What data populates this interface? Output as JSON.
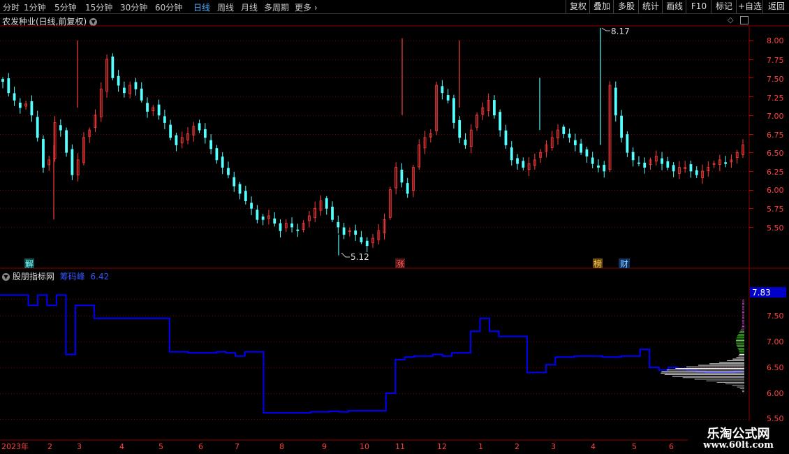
{
  "toolbar": {
    "periods": [
      "分时",
      "1分钟",
      "5分钟",
      "15分钟",
      "30分钟",
      "60分钟",
      "日线",
      "周线",
      "月线",
      "多周期",
      "更多"
    ],
    "active_period": "日线",
    "right_buttons": [
      "复权",
      "叠加",
      "多股",
      "统计",
      "画线",
      "F10",
      "标记",
      "+自选",
      "返回"
    ]
  },
  "main_panel": {
    "title": "农发种业(日线,前复权)",
    "high_label": "8.17",
    "low_label": "5.12",
    "y_ticks": [
      "8.00",
      "7.75",
      "7.50",
      "7.25",
      "7.00",
      "6.75",
      "6.50",
      "6.25",
      "6.00",
      "5.75",
      "5.50"
    ],
    "markers": [
      "解",
      "涨",
      "榜",
      "财"
    ]
  },
  "indicator_panel": {
    "title": "股朋指标网",
    "line_name": "筹码峰",
    "line_value": "6.42",
    "y_ticks": [
      "7.50",
      "7.00",
      "6.50",
      "6.00",
      "5.50"
    ],
    "current_label": "7.83"
  },
  "x_axis": {
    "labels": [
      "2023年",
      "2",
      "3",
      "4",
      "5",
      "6",
      "7",
      "8",
      "9",
      "10",
      "11",
      "12",
      "1",
      "2",
      "3",
      "4",
      "5",
      "6"
    ]
  },
  "watermark": {
    "line1": "乐淘公式网",
    "line2": "www.60lt.com"
  },
  "colors": {
    "up": "#ff3c3c",
    "down": "#54ffff",
    "indicator_line": "#0000ff",
    "active": "#4fb0ff"
  },
  "chart_data": {
    "type": "candlestick",
    "y_range": [
      5.2,
      8.15
    ],
    "high": 8.17,
    "low": 5.12,
    "close_series": [
      7.45,
      7.3,
      7.2,
      7.1,
      7.15,
      7.0,
      6.7,
      6.3,
      6.4,
      6.9,
      6.8,
      6.5,
      6.2,
      6.4,
      6.7,
      6.8,
      7.0,
      7.35,
      7.75,
      7.5,
      7.4,
      7.3,
      7.4,
      7.35,
      7.2,
      7.05,
      7.1,
      7.0,
      6.9,
      6.7,
      6.6,
      6.7,
      6.75,
      6.85,
      6.8,
      6.7,
      6.55,
      6.4,
      6.3,
      6.2,
      6.05,
      5.95,
      5.85,
      5.75,
      5.6,
      5.6,
      5.65,
      5.55,
      5.45,
      5.55,
      5.5,
      5.45,
      5.55,
      5.65,
      5.75,
      5.85,
      5.75,
      5.6,
      5.5,
      5.4,
      5.45,
      5.4,
      5.3,
      5.25,
      5.35,
      5.45,
      5.6,
      6.0,
      6.3,
      6.1,
      5.95,
      6.3,
      6.6,
      6.7,
      6.75,
      7.4,
      7.3,
      7.2,
      6.9,
      6.7,
      6.6,
      6.8,
      7.0,
      7.1,
      7.2,
      7.0,
      6.8,
      6.6,
      6.4,
      6.35,
      6.3,
      6.35,
      6.4,
      6.5,
      6.6,
      6.7,
      6.8,
      6.75,
      6.7,
      6.6,
      6.5,
      6.45,
      6.35,
      6.3,
      6.25,
      7.4,
      7.0,
      6.7,
      6.5,
      6.4,
      6.35,
      6.3,
      6.4,
      6.45,
      6.35,
      6.3,
      6.25,
      6.3,
      6.3,
      6.25,
      6.2,
      6.25,
      6.3,
      6.35,
      6.4,
      6.35,
      6.4,
      6.5,
      6.6
    ],
    "indicator_series": [
      7.9,
      7.9,
      7.9,
      7.7,
      7.9,
      7.7,
      7.9,
      6.75,
      7.7,
      7.7,
      7.45,
      7.45,
      7.45,
      7.45,
      7.45,
      7.45,
      7.45,
      7.45,
      6.8,
      6.8,
      6.78,
      6.78,
      6.78,
      6.8,
      6.78,
      6.72,
      6.8,
      6.8,
      5.62,
      5.62,
      5.62,
      5.62,
      5.62,
      5.64,
      5.64,
      5.65,
      5.64,
      5.66,
      5.66,
      5.66,
      5.66,
      6.0,
      6.65,
      6.7,
      6.72,
      6.72,
      6.75,
      6.72,
      6.78,
      6.78,
      7.2,
      7.45,
      7.2,
      7.1,
      7.1,
      7.1,
      6.4,
      6.4,
      6.55,
      6.7,
      6.7,
      6.72,
      6.72,
      6.72,
      6.7,
      6.7,
      6.72,
      6.72,
      6.85,
      6.5,
      6.45,
      6.5,
      6.48,
      6.45,
      6.42,
      6.4,
      6.4,
      6.4,
      6.42,
      6.42
    ],
    "indicator_range": [
      5.55,
      8.0
    ]
  }
}
